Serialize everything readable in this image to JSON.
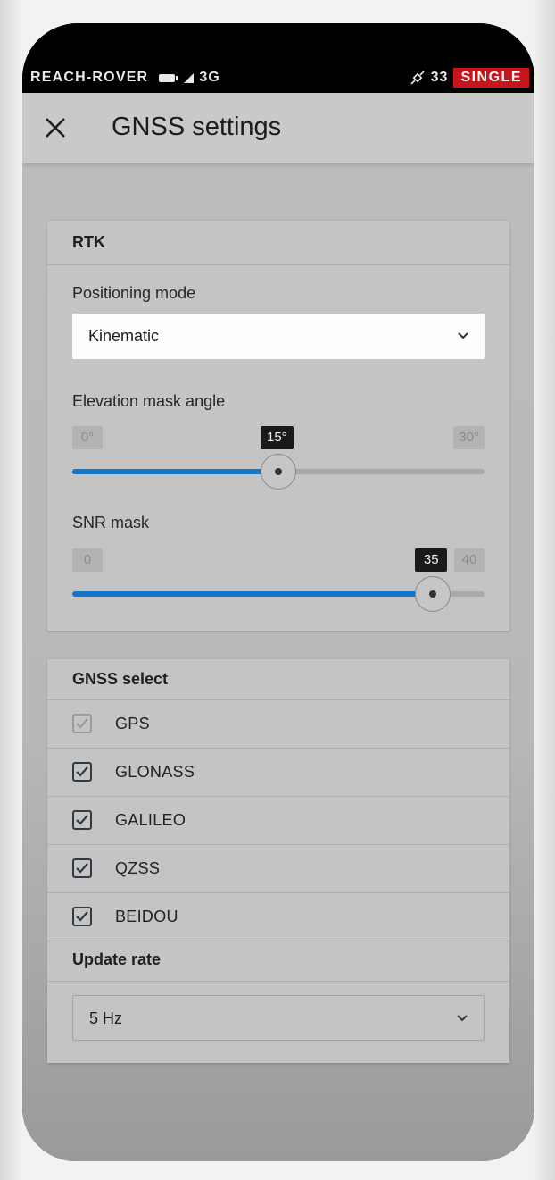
{
  "status_bar": {
    "device_name": "REACH-ROVER",
    "network": "3G",
    "satellite_count": "33",
    "solution_status": "SINGLE",
    "solution_color": "#c8141b"
  },
  "appbar": {
    "title": "GNSS settings",
    "close_icon": "close-icon"
  },
  "rtk": {
    "header": "RTK",
    "positioning_mode": {
      "label": "Positioning mode",
      "value": "Kinematic"
    },
    "elevation_mask": {
      "label": "Elevation mask angle",
      "min": "0°",
      "max": "30°",
      "value": "15°",
      "fraction": 0.5
    },
    "snr_mask": {
      "label": "SNR mask",
      "min": "0",
      "max": "40",
      "value": "35",
      "fraction": 0.875
    }
  },
  "gnss_select": {
    "header": "GNSS select",
    "items": [
      {
        "label": "GPS",
        "checked": true,
        "disabled": true
      },
      {
        "label": "GLONASS",
        "checked": true,
        "disabled": false
      },
      {
        "label": "GALILEO",
        "checked": true,
        "disabled": false
      },
      {
        "label": "QZSS",
        "checked": true,
        "disabled": false
      },
      {
        "label": "BEIDOU",
        "checked": true,
        "disabled": false
      }
    ]
  },
  "update_rate": {
    "label": "Update rate",
    "value": "5 Hz"
  },
  "accent_color": "#1476c8"
}
